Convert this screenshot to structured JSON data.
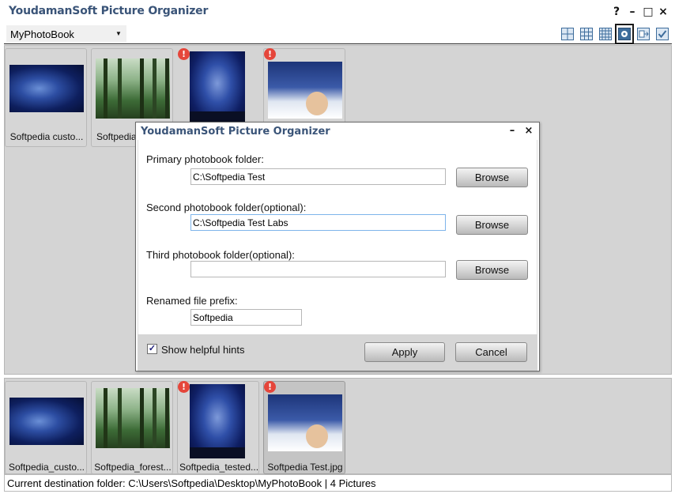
{
  "window": {
    "title": "YoudamanSoft Picture Organizer",
    "help": "?",
    "minimize": "–",
    "maximize": "□",
    "close": "×"
  },
  "toolbar": {
    "photobook_select": "MyPhotoBook",
    "view_buttons": [
      "large-grid-icon",
      "medium-grid-icon",
      "small-grid-icon",
      "settings-view-icon",
      "export-icon",
      "check-icon"
    ]
  },
  "top_thumbnails": [
    {
      "caption": "Softpedia custo...",
      "warning": false
    },
    {
      "caption": "Softpedia",
      "warning": false
    },
    {
      "caption": "",
      "warning": true
    },
    {
      "caption": "",
      "warning": true
    }
  ],
  "bottom_thumbnails": [
    {
      "caption": "Softpedia_custo...",
      "warning": false
    },
    {
      "caption": "Softpedia_forest...",
      "warning": false
    },
    {
      "caption": "Softpedia_tested...",
      "warning": true
    },
    {
      "caption": "Softpedia Test.jpg",
      "warning": true
    }
  ],
  "warn_symbol": "!",
  "status": {
    "text": "Current destination folder: C:\\Users\\Softpedia\\Desktop\\MyPhotoBook   | 4 Pictures"
  },
  "dialog": {
    "title": "YoudamanSoft Picture Organizer",
    "minimize": "–",
    "close": "×",
    "primary_label": "Primary photobook folder:",
    "primary_value": "C:\\Softpedia Test",
    "second_label": "Second photobook folder(optional):",
    "second_value": "C:\\Softpedia Test Labs",
    "third_label": "Third photobook folder(optional):",
    "third_value": "",
    "prefix_label": "Renamed file prefix:",
    "prefix_value": "Softpedia",
    "browse": "Browse",
    "hints_label": "Show helpful hints",
    "hints_checked": true,
    "check_mark": "✓",
    "apply": "Apply",
    "cancel": "Cancel"
  }
}
